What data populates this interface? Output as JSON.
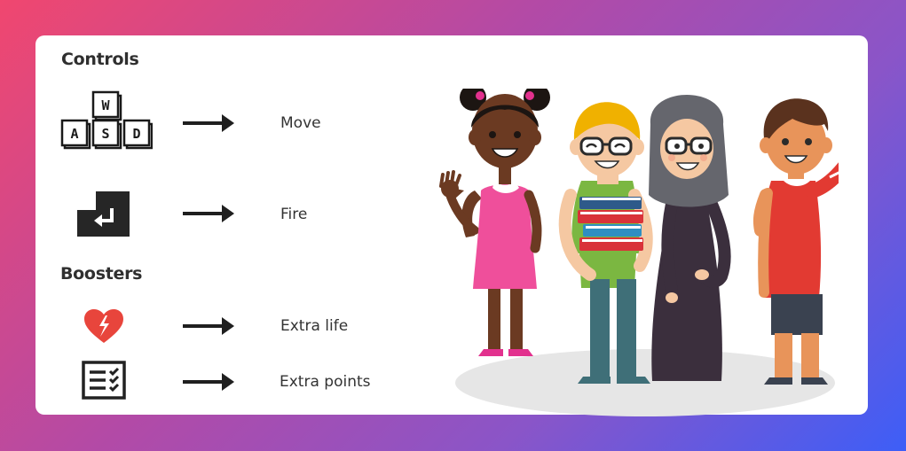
{
  "controls": {
    "title": "Controls",
    "items": [
      {
        "icon": "wasd-keys-icon",
        "label": "Move"
      },
      {
        "icon": "enter-key-icon",
        "label": "Fire"
      }
    ],
    "keys": [
      "W",
      "A",
      "S",
      "D"
    ]
  },
  "boosters": {
    "title": "Boosters",
    "items": [
      {
        "icon": "broken-heart-icon",
        "label": "Extra life"
      },
      {
        "icon": "checklist-icon",
        "label": "Extra points"
      }
    ]
  },
  "colors": {
    "background_start": "#f0476f",
    "background_end": "#3d5ef7",
    "card": "#ffffff",
    "text": "#333333",
    "heart": "#e8453c"
  }
}
